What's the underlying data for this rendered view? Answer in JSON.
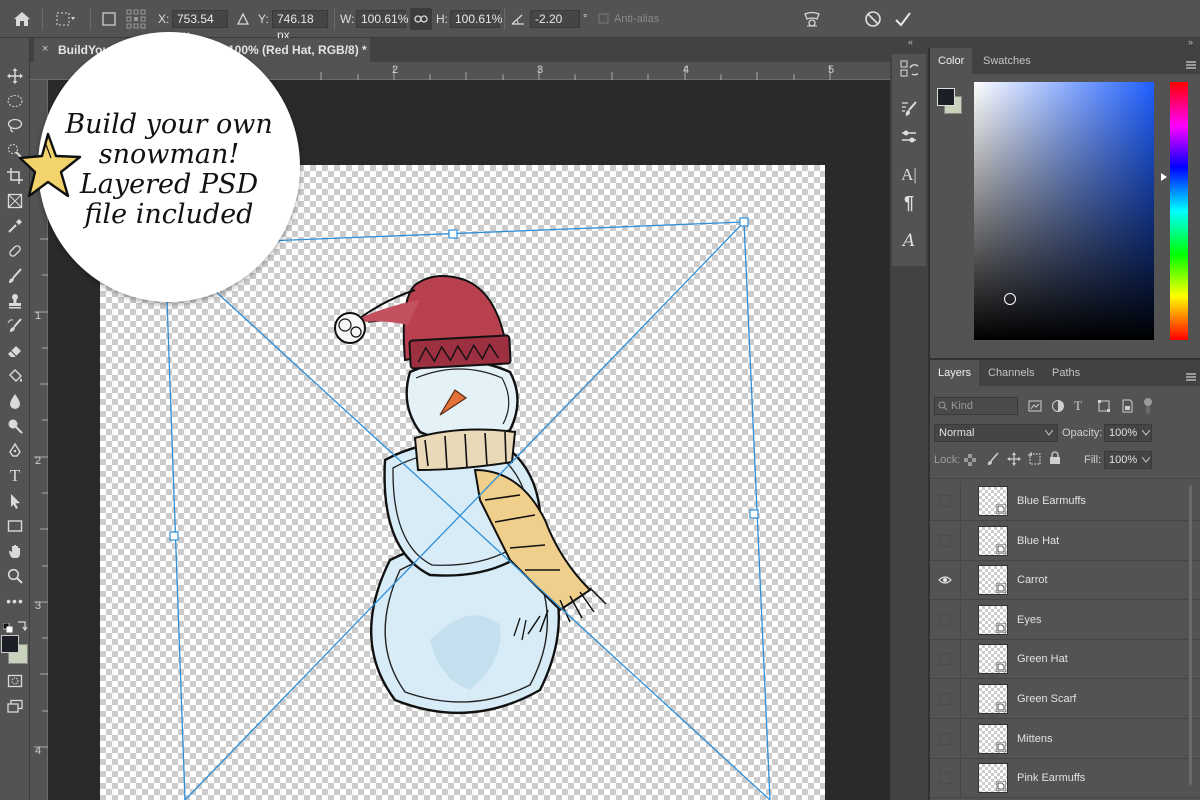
{
  "options_bar": {
    "x_label": "X:",
    "x_value": "753.54 px",
    "y_label": "Y:",
    "y_value": "746.18 px",
    "w_label": "W:",
    "w_value": "100.61%",
    "h_label": "H:",
    "h_value": "100.61%",
    "angle_value": "-2.20",
    "angle_unit": "°",
    "antialias_label": "Anti-alias"
  },
  "document_tab": {
    "title_start": "BuildYou",
    "title_end": "100% (Red Hat, RGB/8) *",
    "close": "×"
  },
  "rulers": {
    "top": [
      "2",
      "3",
      "4",
      "5"
    ],
    "left": [
      "1",
      "2",
      "3",
      "4"
    ]
  },
  "promo": {
    "line1": "Build your own",
    "line2": "snowman!",
    "line3": "Layered PSD",
    "line4": "file included"
  },
  "color_panel": {
    "tabs": [
      "Color",
      "Swatches"
    ],
    "active_tab": "Color"
  },
  "layers_panel": {
    "tabs": [
      "Layers",
      "Channels",
      "Paths"
    ],
    "active_tab": "Layers",
    "filter_kind": "Kind",
    "blend_mode": "Normal",
    "opacity_label": "Opacity:",
    "opacity_value": "100%",
    "lock_label": "Lock:",
    "fill_label": "Fill:",
    "fill_value": "100%",
    "layers": [
      {
        "name": "Blue Earmuffs",
        "visible": false
      },
      {
        "name": "Blue Hat",
        "visible": false
      },
      {
        "name": "Carrot",
        "visible": true
      },
      {
        "name": "Eyes",
        "visible": false
      },
      {
        "name": "Green Hat",
        "visible": false
      },
      {
        "name": "Green Scarf",
        "visible": false
      },
      {
        "name": "Mittens",
        "visible": false
      },
      {
        "name": "Pink Earmuffs",
        "visible": false
      }
    ]
  },
  "colors": {
    "selection_blue": "#2f8fd8",
    "hat_red": "#b8404f",
    "scarf_tan": "#e8c585",
    "snow_blue": "#bfe0ef"
  }
}
